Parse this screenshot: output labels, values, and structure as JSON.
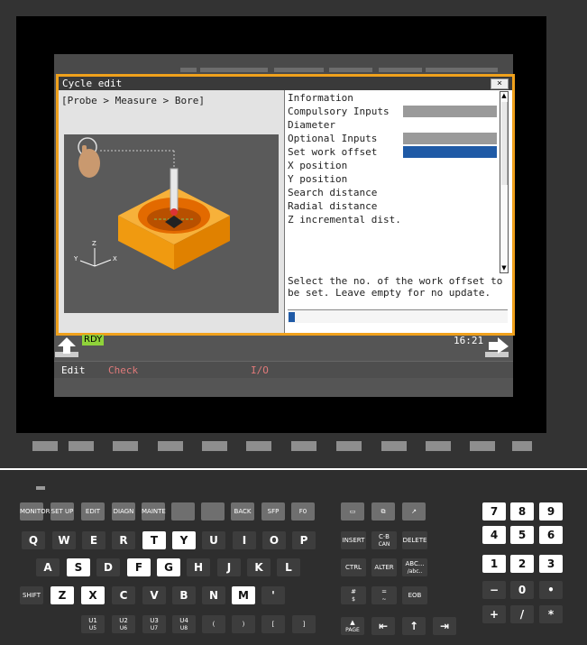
{
  "dialog": {
    "title": "Cycle edit",
    "close_label": "×",
    "breadcrumb": "[Probe > Measure > Bore]",
    "params": [
      {
        "label": "Information",
        "box": "none"
      },
      {
        "label": "Compulsory Inputs",
        "box": "gray"
      },
      {
        "label": "Diameter",
        "box": "none"
      },
      {
        "label": "Optional Inputs",
        "box": "gray"
      },
      {
        "label": "Set work offset",
        "box": "selected"
      },
      {
        "label": "X position",
        "box": "none"
      },
      {
        "label": "Y position",
        "box": "none"
      },
      {
        "label": "Search distance",
        "box": "none"
      },
      {
        "label": "Radial distance",
        "box": "none"
      },
      {
        "label": "Z incremental dist.",
        "box": "none"
      }
    ],
    "hint": "Select the no. of the work offset to be set. Leave empty for no update.",
    "input_value": ""
  },
  "status": {
    "rdy": "RDY",
    "time": "16:21"
  },
  "softkeys": {
    "edit": "Edit",
    "check": "Check",
    "io": "I/O"
  },
  "colors": {
    "accent": "#f0a11c",
    "selection": "#1f5aa6",
    "rdy": "#8fd23a"
  },
  "keys": {
    "func_row": [
      "MONITOR",
      "SET UP",
      "EDIT",
      "DIAGN",
      "MAINTE",
      "",
      "",
      "BACK",
      "SFP",
      "F0"
    ],
    "letters_r1": [
      "Q",
      "W",
      "E",
      "R",
      "T",
      "Y",
      "U",
      "I",
      "O",
      "P"
    ],
    "letters_r2": [
      "A",
      "S",
      "D",
      "F",
      "G",
      "H",
      "J",
      "K",
      "L"
    ],
    "letters_r3": [
      "SHIFT",
      "Z",
      "X",
      "C",
      "V",
      "B",
      "N",
      "M",
      "'"
    ],
    "u_row": [
      "U1",
      "U2",
      "U3",
      "U4",
      "(",
      ")",
      "[",
      "]"
    ],
    "u_sub": [
      "U5",
      "U6",
      "U7",
      "U8"
    ],
    "edit_keys": [
      "INSERT",
      "C·B",
      "DELETE",
      "CTRL",
      "ALTER",
      "ABC...",
      "#",
      "=",
      "EOB"
    ],
    "edit_keys_sub": {
      "cb": "CAN",
      "abc": "/abc..",
      "hash": "$",
      "eq": "~",
      "eob": "/"
    },
    "num_r1": [
      "7",
      "8",
      "9"
    ],
    "num_r2": [
      "4",
      "5",
      "6"
    ],
    "num_r3": [
      "1",
      "2",
      "3"
    ],
    "num_r4": [
      "−",
      "0",
      "•"
    ],
    "num_r5": [
      "+",
      "/",
      "*"
    ],
    "page_label": "PAGE"
  }
}
